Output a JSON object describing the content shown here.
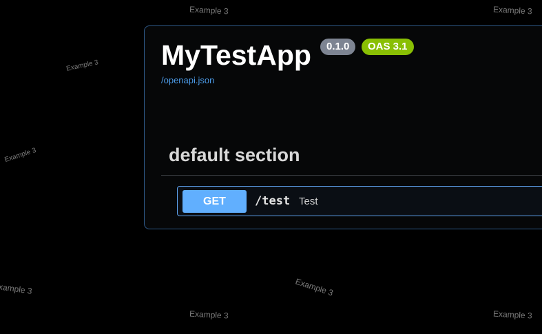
{
  "watermark": {
    "text": "Example 3"
  },
  "info": {
    "title": "MyTestApp",
    "version_badge": "0.1.0",
    "oas_badge": "OAS 3.1",
    "spec_link": "/openapi.json"
  },
  "tag_section": {
    "title": "default section"
  },
  "operations": [
    {
      "method": "GET",
      "path": "/test",
      "summary": "Test"
    }
  ],
  "colors": {
    "background": "#000000",
    "panel_border": "#2f5a8a",
    "version_badge": "#7d8492",
    "oas_badge": "#89bf04",
    "get_method": "#61affe",
    "link": "#4c9be8"
  }
}
